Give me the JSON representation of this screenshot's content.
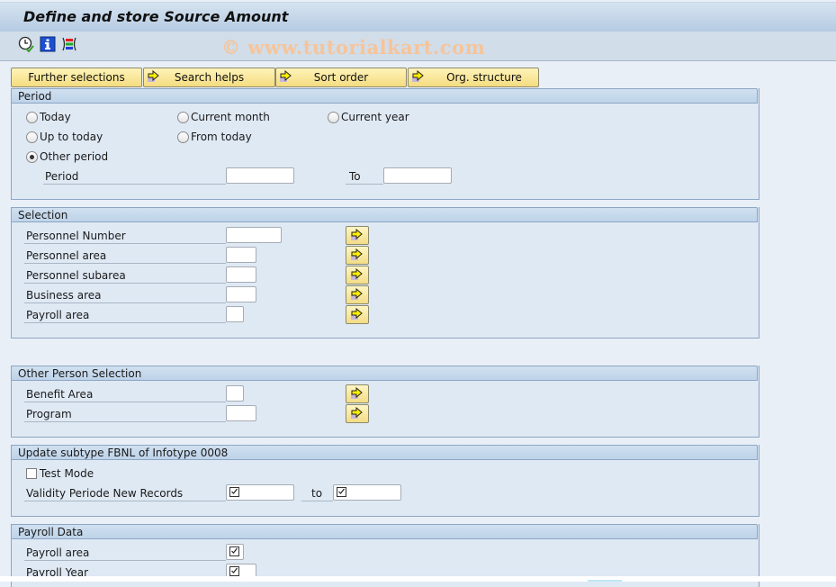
{
  "window": {
    "title": "Define and store Source Amount",
    "watermark": "© www.tutorialkart.com"
  },
  "toolbar": {
    "icons": [
      "execute-clock-icon",
      "info-icon",
      "selection-options-icon"
    ]
  },
  "selection_buttons": [
    {
      "label": "Further selections",
      "icon": null
    },
    {
      "label": "Search helps",
      "icon": "arrow-right-icon"
    },
    {
      "label": "Sort order",
      "icon": "arrow-right-icon"
    },
    {
      "label": "Org. structure",
      "icon": "arrow-right-icon"
    }
  ],
  "period": {
    "header": "Period",
    "options": [
      {
        "label": "Today",
        "selected": false
      },
      {
        "label": "Current month",
        "selected": false
      },
      {
        "label": "Current year",
        "selected": false
      },
      {
        "label": "Up to today",
        "selected": false
      },
      {
        "label": "From today",
        "selected": false
      },
      {
        "label": "Other period",
        "selected": true
      }
    ],
    "period_label": "Period",
    "period_from": "",
    "to_label": "To",
    "period_to": ""
  },
  "selection": {
    "header": "Selection",
    "fields": [
      {
        "label": "Personnel Number",
        "value": ""
      },
      {
        "label": "Personnel area",
        "value": ""
      },
      {
        "label": "Personnel subarea",
        "value": ""
      },
      {
        "label": "Business area",
        "value": ""
      },
      {
        "label": "Payroll area",
        "value": ""
      }
    ]
  },
  "other_person": {
    "header": "Other Person Selection",
    "fields": [
      {
        "label": "Benefit Area",
        "value": ""
      },
      {
        "label": "Program",
        "value": ""
      }
    ]
  },
  "update": {
    "header": "Update subtype FBNL of Infotype 0008",
    "test_mode_label": "Test Mode",
    "test_mode_checked": false,
    "validity_label": "Validity Periode New Records",
    "validity_from": "",
    "to_label": "to",
    "validity_to": ""
  },
  "payroll": {
    "header": "Payroll Data",
    "fields": [
      {
        "label": "Payroll area",
        "value": ""
      },
      {
        "label": "Payroll Year",
        "value": ""
      }
    ]
  }
}
